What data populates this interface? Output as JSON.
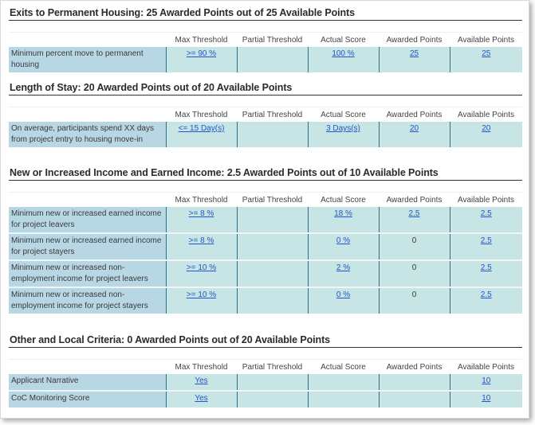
{
  "columns": [
    "Max Threshold",
    "Partial Threshold",
    "Actual Score",
    "Awarded Points",
    "Available Points"
  ],
  "sections": [
    {
      "title": "Exits to Permanent Housing: 25 Awarded Points out of 25 Available Points",
      "rows": [
        {
          "label": "Minimum percent move to permanent housing",
          "max_threshold": ">= 90 %",
          "partial_threshold": "",
          "actual_score": "100 %",
          "awarded_points": "25",
          "available_points": "25"
        }
      ]
    },
    {
      "title": "Length of Stay: 20 Awarded Points out of 20 Available Points",
      "rows": [
        {
          "label": "On average, participants spend XX days from project entry to housing move-in",
          "max_threshold": "<= 15 Day(s)",
          "partial_threshold": "",
          "actual_score": "3 Days(s)",
          "awarded_points": "20",
          "available_points": "20"
        }
      ]
    },
    {
      "title": "New or Increased Income and Earned Income: 2.5 Awarded Points out of 10 Available Points",
      "rows": [
        {
          "label": "Minimum new or increased earned income for project leavers",
          "max_threshold": ">= 8 %",
          "partial_threshold": "",
          "actual_score": "18 %",
          "awarded_points": "2.5",
          "available_points": "2.5"
        },
        {
          "label": "Minimum new or increased earned income for project stayers",
          "max_threshold": ">= 8 %",
          "partial_threshold": "",
          "actual_score": "0 %",
          "awarded_points": "0",
          "available_points": "2.5"
        },
        {
          "label": "Minimum new or increased non-employment income for project leavers",
          "max_threshold": ">= 10 %",
          "partial_threshold": "",
          "actual_score": "2 %",
          "awarded_points": "0",
          "available_points": "2.5"
        },
        {
          "label": "Minimum new or increased non-employment income for project stayers",
          "max_threshold": ">= 10 %",
          "partial_threshold": "",
          "actual_score": "0 %",
          "awarded_points": "0",
          "available_points": "2.5"
        }
      ]
    },
    {
      "title": "Other and Local Criteria: 0 Awarded Points out of 20 Available Points",
      "rows": [
        {
          "label": "Applicant Narrative",
          "max_threshold": "Yes",
          "partial_threshold": "",
          "actual_score": "",
          "awarded_points": "",
          "available_points": "10"
        },
        {
          "label": "CoC Monitoring Score",
          "max_threshold": "Yes",
          "partial_threshold": "",
          "actual_score": "",
          "awarded_points": "",
          "available_points": "10"
        }
      ]
    }
  ],
  "colors": {
    "label_bg": "#b8d7e4",
    "cell_bg": "#c7e5e4",
    "link": "#2255cc",
    "divider": "#2f6f8a"
  }
}
